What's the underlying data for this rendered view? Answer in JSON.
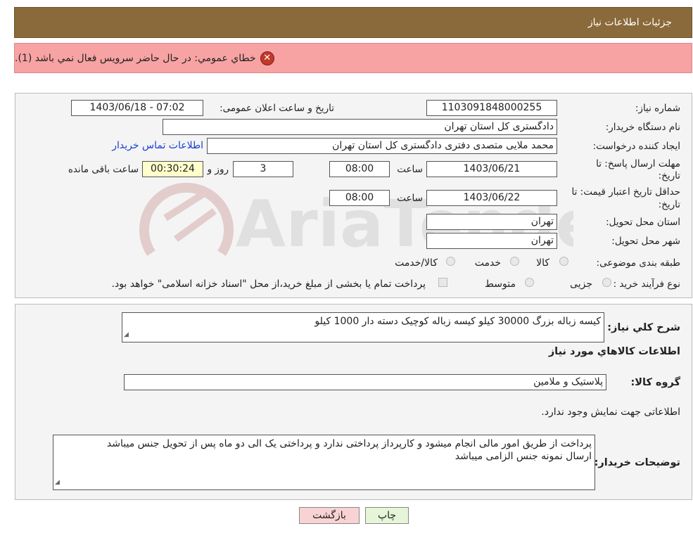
{
  "header": {
    "title": "جزئیات اطلاعات نیاز"
  },
  "error": {
    "icon": "error-x-icon",
    "message": "خطاي عمومي: در حال حاضر سرويس فعال نمي باشد (1)."
  },
  "watermark": {
    "text": "AriaTender.neT"
  },
  "form": {
    "need_number_label": "شماره نیاز:",
    "need_number": "1103091848000255",
    "announce_label": "تاریخ و ساعت اعلان عمومی:",
    "announce_value": "1403/06/18 - 07:02",
    "buyer_label": "نام دستگاه خریدار:",
    "buyer_value": "دادگستری کل استان تهران",
    "creator_label": "ایجاد کننده درخواست:",
    "creator_value": "محمد ملایی متصدی دفتری دادگستری کل استان تهران",
    "contact_link": "اطلاعات تماس خریدار",
    "deadline_label_1": "مهلت ارسال پاسخ: تا",
    "deadline_label_2": "تاریخ:",
    "deadline_date": "1403/06/21",
    "time_label": "ساعت",
    "deadline_time": "08:00",
    "days_value": "3",
    "days_label": "روز و",
    "remaining_value": "00:30:24",
    "remaining_label": "ساعت باقی مانده",
    "validity_label_1": "حداقل تاریخ اعتبار قیمت: تا",
    "validity_label_2": "تاریخ:",
    "validity_date": "1403/06/22",
    "validity_time": "08:00",
    "province_label": "استان محل تحویل:",
    "province_value": "تهران",
    "city_label": "شهر محل تحویل:",
    "city_value": "تهران",
    "category_label": "طبقه بندی موضوعی:",
    "category_options": [
      "کالا",
      "خدمت",
      "کالا/خدمت"
    ],
    "process_label": "نوع فرآیند خرید :",
    "process_options": [
      "جزیی",
      "متوسط"
    ],
    "payment_note": "پرداخت تمام یا بخشی از مبلغ خرید،از محل \"اسناد خزانه اسلامی\" خواهد بود."
  },
  "details": {
    "summary_label": "شرح کلي نياز:",
    "summary_value": "کیسه زباله  بزرگ 30000 کیلو کیسه زباله کوچیک دسته دار 1000 کیلو",
    "goods_heading": "اطلاعات کالاهاي مورد نياز",
    "group_label": "گروه کالا:",
    "group_value": "پلاستیک و ملامین",
    "no_info": "اطلاعاتی جهت نمایش وجود ندارد.",
    "buyer_notes_label": "توضیحات خریدار:",
    "buyer_notes_line1": "پرداخت از طریق امور مالی انجام میشود و کارپرداز پرداختی ندارد  و پرداختی یک الی دو ماه پس از تحویل جنس  میباشد",
    "buyer_notes_line2": "ارسال نمونه جنس الزامی میباشد"
  },
  "buttons": {
    "print": "چاپ",
    "back": "بازگشت"
  },
  "colors": {
    "header": "#8a6a3a",
    "error_bg": "#f7a3a3",
    "print_btn": "#e6f5d8",
    "back_btn": "#f9d3d3",
    "link": "#1a3ed4"
  }
}
